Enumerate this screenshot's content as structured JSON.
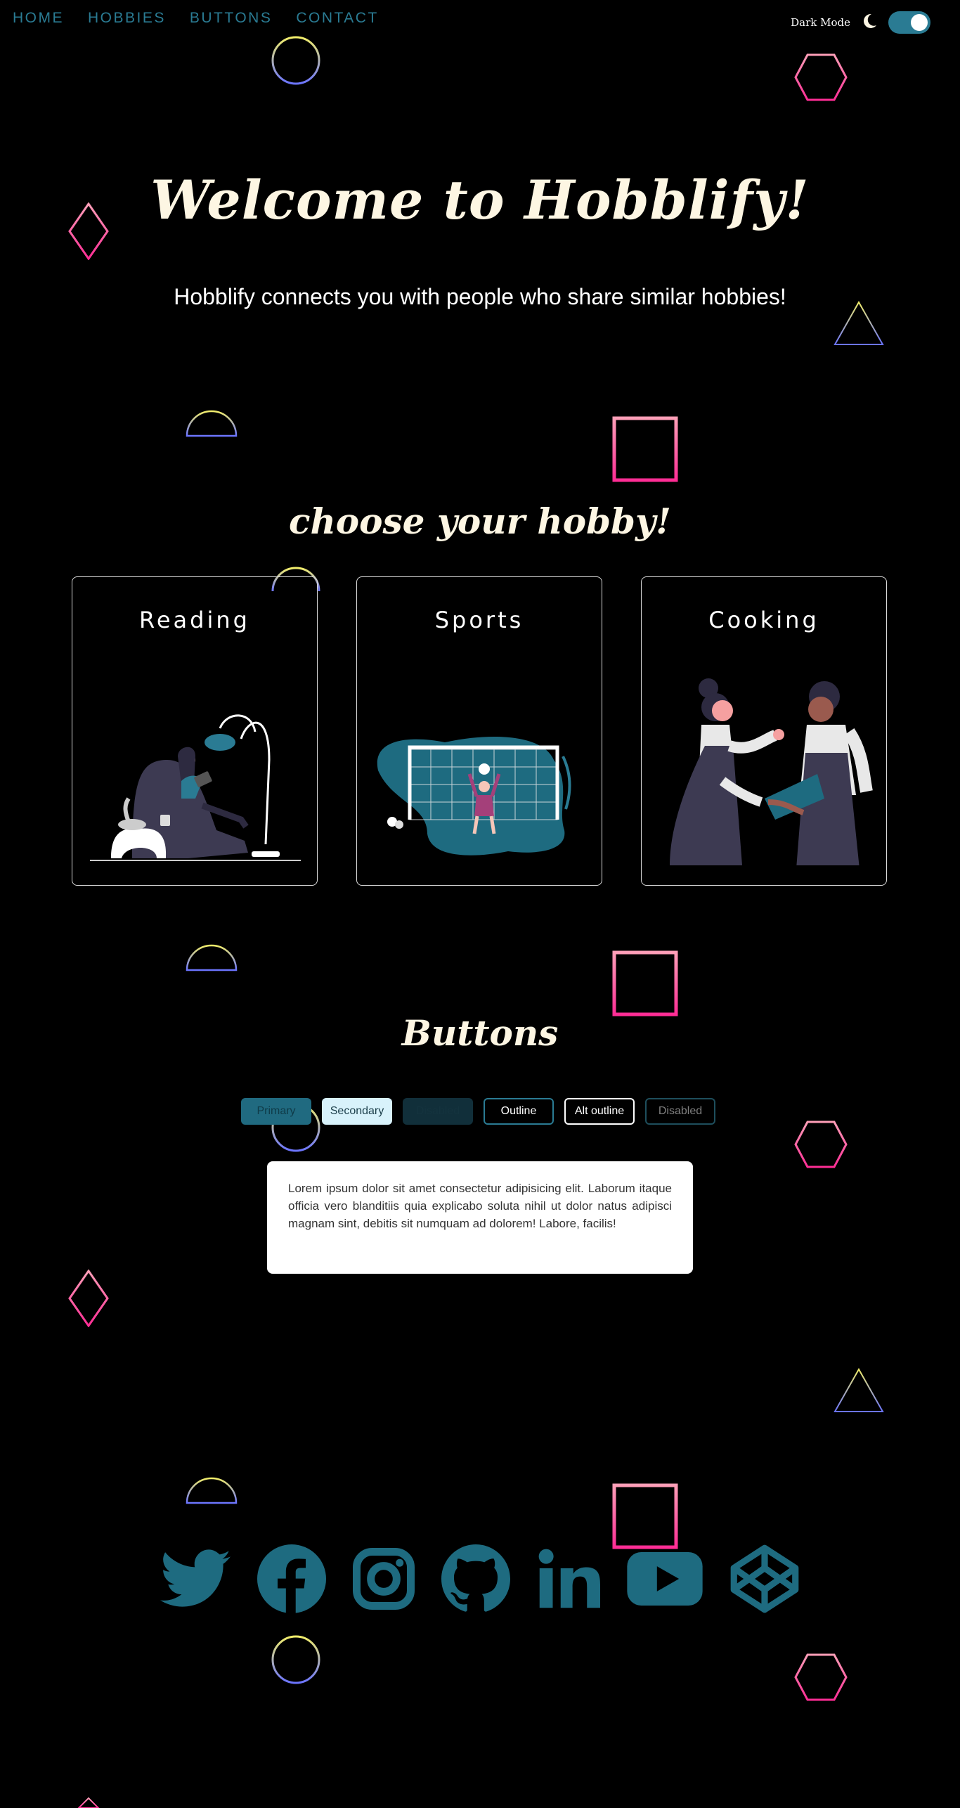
{
  "nav": {
    "items": [
      "HOME",
      "HOBBIES",
      "BUTTONS",
      "CONTACT"
    ]
  },
  "dark_mode": {
    "label": "Dark Mode",
    "enabled": true
  },
  "hero": {
    "title": "Welcome to Hobblify!",
    "subtitle": "Hobblify connects you with people who share similar hobbies!"
  },
  "hobbies": {
    "heading": "choose your hobby!",
    "cards": [
      {
        "title": "Reading"
      },
      {
        "title": "Sports"
      },
      {
        "title": "Cooking"
      }
    ]
  },
  "buttons": {
    "heading": "Buttons",
    "primary": "Primary",
    "secondary": "Secondary",
    "disabled": "Disabled",
    "outline": "Outline",
    "alt_outline": "Alt outline",
    "outline_disabled": "Disabled"
  },
  "lorem": "Lorem ipsum dolor sit amet consectetur adipisicing elit. Laborum itaque officia vero blanditiis quia explicabo soluta nihil ut dolor natus adipisci magnam sint, debitis sit numquam ad dolorem! Labore, facilis!",
  "social": {
    "icons": [
      "twitter-icon",
      "facebook-icon",
      "instagram-icon",
      "github-icon",
      "linkedin-icon",
      "youtube-icon",
      "codepen-icon"
    ]
  },
  "colors": {
    "accent": "#2a7b93",
    "title": "#fdf6e3",
    "shape_pink": "#ff4d9a",
    "shape_yellow": "#eef06a",
    "shape_blue": "#6b7bff"
  }
}
